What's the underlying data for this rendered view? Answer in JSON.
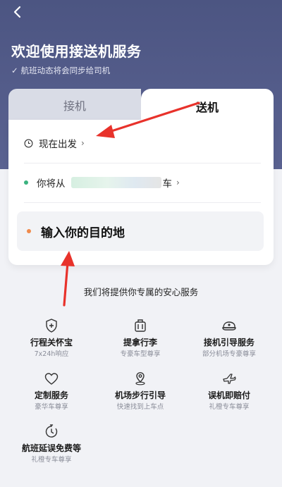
{
  "header": {
    "title": "欢迎使用接送机服务",
    "subtitle_check": "✓",
    "subtitle": "航班动态将会同步给司机",
    "background": "#4c5582"
  },
  "tabs": [
    {
      "label": "接机",
      "active": false
    },
    {
      "label": "送机",
      "active": true
    }
  ],
  "trip": {
    "time_label": "现在出发",
    "from_prefix": "你将从",
    "from_suffix": "车",
    "destination_placeholder": "输入你的目的地",
    "origin_dot_color": "#3bb27f",
    "dest_dot_color": "#f08a4b",
    "chevron": "›"
  },
  "services": {
    "title": "我们将提供你专属的安心服务",
    "items": [
      {
        "name": "行程关怀宝",
        "desc": "7x24h响应",
        "icon": "shield-plus-icon"
      },
      {
        "name": "提拿行李",
        "desc": "专豪车型尊享",
        "icon": "luggage-icon"
      },
      {
        "name": "接机引导服务",
        "desc": "部分机场专豪尊享",
        "icon": "hat-icon"
      },
      {
        "name": "定制服务",
        "desc": "豪华车尊享",
        "icon": "heart-icon"
      },
      {
        "name": "机场步行引导",
        "desc": "快速找到上车点",
        "icon": "location-icon"
      },
      {
        "name": "误机即赔付",
        "desc": "礼橙专车尊享",
        "icon": "plane-icon"
      },
      {
        "name": "航班延误免费等",
        "desc": "礼橙专车尊享",
        "icon": "timer-icon"
      }
    ]
  },
  "annotation_color": "#e8322b"
}
